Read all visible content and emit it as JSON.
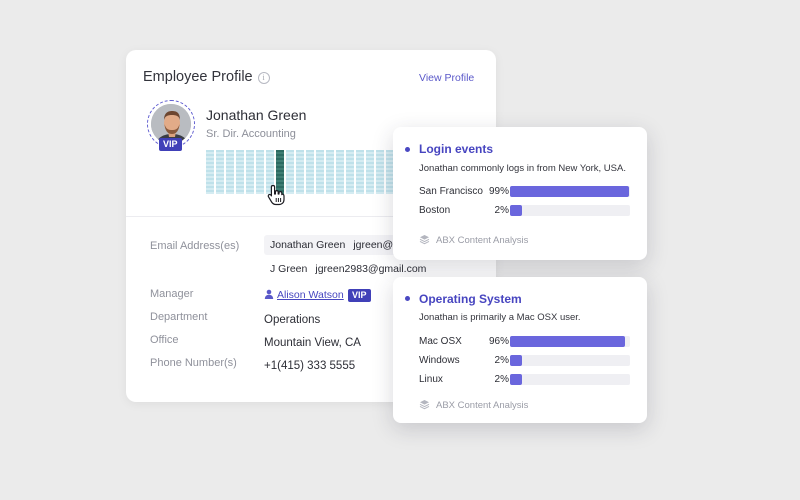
{
  "profile": {
    "title": "Employee Profile",
    "view_profile_label": "View Profile",
    "name": "Jonathan Green",
    "role": "Sr. Dir. Accounting",
    "vip_label": "VIP",
    "activity_columns": 19,
    "activity_active_index": 7,
    "fields": {
      "email_label": "Email Address(es)",
      "emails": [
        {
          "name": "Jonathan Green",
          "address": "jgreen@co"
        },
        {
          "name": "J Green",
          "address": "jgreen2983@gmail.com"
        }
      ],
      "manager_label": "Manager",
      "manager_name": "Alison Watson",
      "manager_vip": "VIP",
      "department_label": "Department",
      "department_value": "Operations",
      "office_label": "Office",
      "office_value": "Mountain View, CA",
      "phone_label": "Phone Number(s)",
      "phone_value": "+1(415) 333 5555"
    }
  },
  "login_events": {
    "title": "Login events",
    "description": "Jonathan commonly logs in from New York, USA.",
    "rows": [
      {
        "label": "San Francisco",
        "pct_label": "99%",
        "value": 0.99
      },
      {
        "label": "Boston",
        "pct_label": "2%",
        "value": 0.02
      }
    ],
    "footer": "ABX Content Analysis"
  },
  "operating_system": {
    "title": "Operating System",
    "description": "Jonathan is primarily a Mac OSX user.",
    "rows": [
      {
        "label": "Mac OSX",
        "pct_label": "96%",
        "value": 0.96
      },
      {
        "label": "Windows",
        "pct_label": "2%",
        "value": 0.02
      },
      {
        "label": "Linux",
        "pct_label": "2%",
        "value": 0.02
      }
    ],
    "footer": "ABX Content Analysis"
  },
  "colors": {
    "accent": "#4a48c2",
    "bar_fill": "#6a66dd",
    "vip_badge": "#4040b8",
    "activity_active": "#2c6b62",
    "activity_idle": "#bfe1ea"
  },
  "icons": [
    "info-icon",
    "avatar",
    "cursor-hand-icon",
    "person-icon",
    "layers-icon"
  ]
}
